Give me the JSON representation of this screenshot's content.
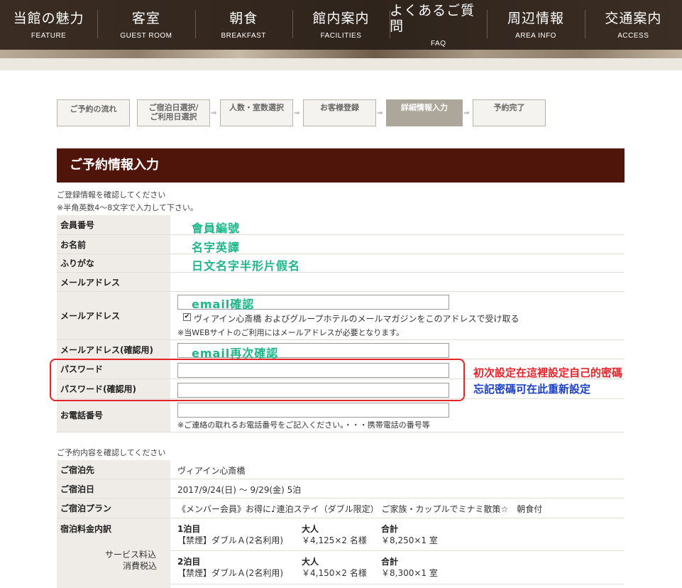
{
  "nav": [
    {
      "jp": "当館の魅力",
      "en": "FEATURE"
    },
    {
      "jp": "客室",
      "en": "GUEST ROOM"
    },
    {
      "jp": "朝食",
      "en": "BREAKFAST"
    },
    {
      "jp": "館内案内",
      "en": "FACILITIES"
    },
    {
      "jp": "よくあるご質問",
      "en": "FAQ"
    },
    {
      "jp": "周辺情報",
      "en": "AREA INFO"
    },
    {
      "jp": "交通案内",
      "en": "ACCESS"
    }
  ],
  "steps": {
    "s1": "ご予約の流れ",
    "s2_line1": "ご宿泊日選択/",
    "s2_line2": "ご利用日選択",
    "s3": "人数・室数選択",
    "s4": "お客様登録",
    "s5": "詳細情報入力",
    "s6": "予約完了",
    "arrow": "⇒"
  },
  "title": "ご予約情報入力",
  "registration": {
    "note1": "ご登録情報を確認してください",
    "note2": "※半角英数4～8文字で入力して下さい。",
    "member_no_label": "会員番号",
    "name_label": "お名前",
    "furigana_label": "ふりがな",
    "email_label": "メールアドレス",
    "email_edit_label": "メールアドレス",
    "newsletter_text": "ヴィアイン心斎橋 およびグループホテルのメールマガジンをこのアドレスで受け取る",
    "newsletter_checked": true,
    "email_required_note": "※当WEBサイトのご利用にはメールアドレスが必要となります。",
    "email_confirm_label": "メールアドレス(確認用)",
    "password_label": "パスワード",
    "password_confirm_label": "パスワード(確認用)",
    "phone_label": "お電話番号",
    "phone_note": "※ご連絡の取れるお電話番号をご記入ください。・・・携帯電話の番号等"
  },
  "annotations": {
    "member_no": "會員編號",
    "name": "名字英譯",
    "furigana": "日文名字半形片假名",
    "email": "email確認",
    "email_confirm": "email再次確認",
    "password_red": "初次設定在這裡設定自己的密碼",
    "password_blue": "忘記密碼可在此重新設定"
  },
  "reservation": {
    "note": "ご予約内容を確認してください",
    "hotel_label": "ご宿泊先",
    "hotel_value": "ヴィアイン心斎橋",
    "date_label": "ご宿泊日",
    "date_value": "2017/9/24(日) ～ 9/29(金) 5泊",
    "plan_label": "ご宿泊プラン",
    "plan_value": "《メンバー会員》お得に♪連泊ステイ（ダブル限定） ご家族・カップルでミナミ散策☆　朝食付",
    "rate_label": "宿泊料金内訳",
    "service_note1": "サービス料込",
    "service_note2": "消費税込",
    "nights": [
      {
        "night": "1泊目",
        "room": "【禁煙】ダブルＡ(2名利用)",
        "adult_hd": "大人",
        "adult": "￥4,125×2 名様",
        "total_hd": "合計",
        "total": "￥8,250×1 室"
      },
      {
        "night": "2泊目",
        "room": "【禁煙】ダブルＡ(2名利用)",
        "adult_hd": "大人",
        "adult": "￥4,150×2 名様",
        "total_hd": "合計",
        "total": "￥8,300×1 室"
      }
    ]
  }
}
